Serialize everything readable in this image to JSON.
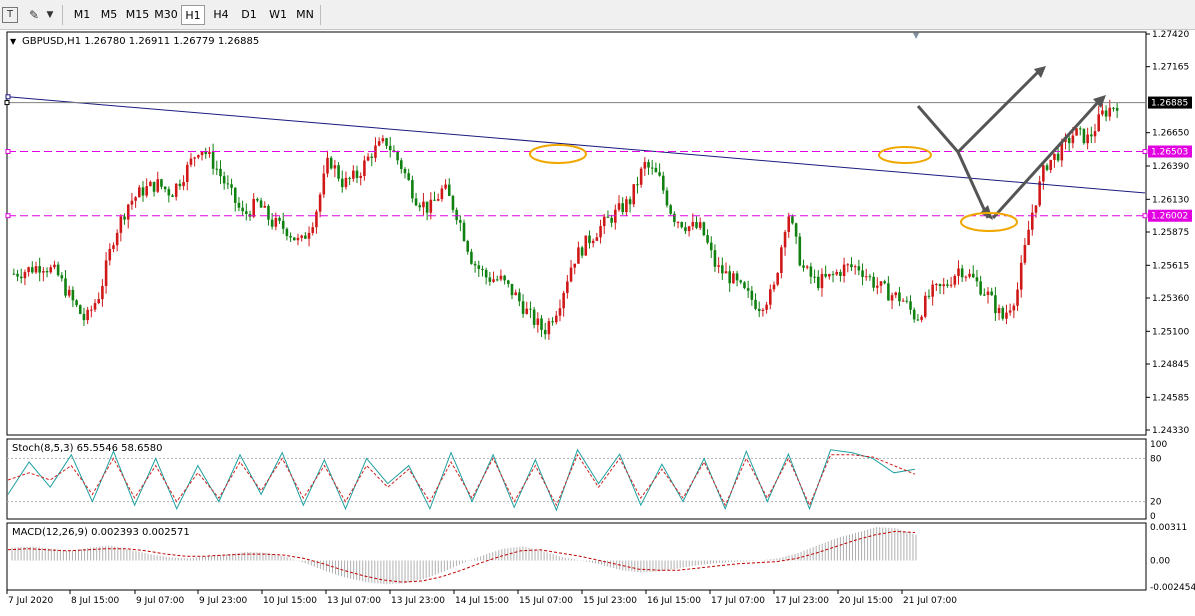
{
  "toolbar": {
    "timeframes": [
      "M1",
      "M5",
      "M15",
      "M30",
      "H1",
      "H4",
      "D1",
      "W1",
      "MN"
    ],
    "active_timeframe": "H1",
    "icons": [
      "text-tool-icon",
      "shapes-tool-icon",
      "dropdown-arrow-icon"
    ]
  },
  "chart_data": [
    {
      "type": "candlestick",
      "title": "GBPUSD,H1  1.26780 1.26911 1.26779 1.26885",
      "symbol": "GBPUSD",
      "timeframe": "H1",
      "ohlc_label": "1.26780 1.26911 1.26779 1.26885",
      "ylim": [
        1.2433,
        1.2742
      ],
      "y_ticks": [
        "1.27420",
        "1.27165",
        "1.26650",
        "1.26390",
        "1.26130",
        "1.25875",
        "1.25615",
        "1.25360",
        "1.25100",
        "1.24845",
        "1.24585",
        "1.24330"
      ],
      "price_labels": {
        "current": "1.26885",
        "resistance": "1.26503",
        "support": "1.26002"
      },
      "levels": {
        "current": 1.26885,
        "resistance": 1.26503,
        "support": 1.26002
      },
      "trendline": {
        "start": [
          0,
          1.2693
        ],
        "end": [
          1,
          1.2618
        ]
      },
      "x_ticks": [
        "7 Jul 2020",
        "8 Jul 15:00",
        "9 Jul 07:00",
        "9 Jul 23:00",
        "10 Jul 15:00",
        "13 Jul 07:00",
        "13 Jul 23:00",
        "14 Jul 15:00",
        "15 Jul 07:00",
        "15 Jul 23:00",
        "16 Jul 15:00",
        "17 Jul 07:00",
        "17 Jul 23:00",
        "20 Jul 15:00",
        "21 Jul 07:00"
      ],
      "anchors": [
        1.2555,
        1.2558,
        1.2562,
        1.2555,
        1.2535,
        1.2518,
        1.254,
        1.2585,
        1.261,
        1.262,
        1.2625,
        1.2618,
        1.2635,
        1.2655,
        1.264,
        1.262,
        1.26,
        1.261,
        1.2595,
        1.259,
        1.2578,
        1.26,
        1.2645,
        1.2625,
        1.2632,
        1.265,
        1.2658,
        1.264,
        1.2615,
        1.2605,
        1.2622,
        1.26,
        1.2565,
        1.2552,
        1.255,
        1.2538,
        1.2522,
        1.251,
        1.253,
        1.2565,
        1.258,
        1.2592,
        1.2602,
        1.2612,
        1.264,
        1.263,
        1.26,
        1.2592,
        1.259,
        1.256,
        1.2552,
        1.254,
        1.253,
        1.254,
        1.2605,
        1.256,
        1.2548,
        1.2552,
        1.256,
        1.256,
        1.2548,
        1.254,
        1.2535,
        1.252,
        1.254,
        1.2545,
        1.256,
        1.255,
        1.2538,
        1.252,
        1.254,
        1.26,
        1.264,
        1.265,
        1.2665,
        1.266,
        1.268,
        1.2688
      ]
    },
    {
      "type": "line",
      "title": "Stoch(8,5,3) 65.5546 58.6580",
      "ylim": [
        0,
        100
      ],
      "y_ticks": [
        "100",
        "80",
        "20",
        "0"
      ],
      "levels": [
        80,
        20
      ],
      "series": [
        {
          "name": "65.5546",
          "color": "#20a0a0",
          "dash": false,
          "values": [
            30,
            75,
            40,
            85,
            20,
            90,
            15,
            80,
            10,
            70,
            20,
            85,
            30,
            88,
            15,
            78,
            10,
            80,
            45,
            70,
            10,
            88,
            20,
            85,
            12,
            78,
            8,
            92,
            45,
            86,
            15,
            72,
            20,
            80,
            10,
            90,
            20,
            86,
            10,
            92,
            88,
            80,
            60,
            65
          ]
        },
        {
          "name": "58.6580",
          "color": "#d02020",
          "dash": true,
          "values": [
            50,
            60,
            50,
            70,
            30,
            80,
            25,
            70,
            20,
            60,
            25,
            75,
            35,
            80,
            25,
            70,
            20,
            70,
            40,
            65,
            20,
            75,
            25,
            80,
            20,
            70,
            15,
            85,
            40,
            80,
            25,
            65,
            25,
            75,
            15,
            80,
            25,
            80,
            15,
            85,
            85,
            82,
            70,
            58
          ]
        }
      ]
    },
    {
      "type": "bar",
      "title": "MACD(12,26,9) 0.002393 0.002571",
      "ylim": [
        -0.002454,
        0.00311
      ],
      "y_ticks": [
        "0.00311",
        "0.00",
        "-0.002454"
      ],
      "series": [
        {
          "name": "0.002393",
          "color": "#b0b0b0",
          "values": [
            0.0012,
            0.0013,
            0.0011,
            0.0009,
            0.0012,
            0.0014,
            0.001,
            0.0006,
            0.0003,
            0.0002,
            0.0004,
            0.0006,
            0.0008,
            0.0007,
            0.0003,
            -0.0003,
            -0.001,
            -0.0016,
            -0.002,
            -0.0022,
            -0.0021,
            -0.0017,
            -0.001,
            -0.0002,
            0.0005,
            0.0011,
            0.0013,
            0.0009,
            0.0003,
            0.0,
            -0.0004,
            -0.0009,
            -0.0011,
            -0.001,
            -0.0007,
            -0.0004,
            -0.0002,
            -0.0001,
            0.0,
            0.0002,
            0.0007,
            0.0014,
            0.0021,
            0.0026,
            0.0031,
            0.003,
            0.0024
          ]
        },
        {
          "name": "0.002571",
          "color": "#c00000",
          "dash": true,
          "values": [
            0.001,
            0.0011,
            0.001,
            0.0009,
            0.001,
            0.0011,
            0.0011,
            0.0009,
            0.0006,
            0.0004,
            0.0004,
            0.0005,
            0.0006,
            0.0006,
            0.0005,
            0.0002,
            -0.0003,
            -0.0009,
            -0.0014,
            -0.0018,
            -0.002,
            -0.0019,
            -0.0015,
            -0.0009,
            -0.0002,
            0.0004,
            0.0009,
            0.001,
            0.0007,
            0.0004,
            0.0,
            -0.0004,
            -0.0008,
            -0.0009,
            -0.0009,
            -0.0007,
            -0.0005,
            -0.0003,
            -0.0002,
            -0.0001,
            0.0002,
            0.0007,
            0.0013,
            0.0019,
            0.0024,
            0.0027,
            0.0026
          ]
        }
      ]
    }
  ]
}
